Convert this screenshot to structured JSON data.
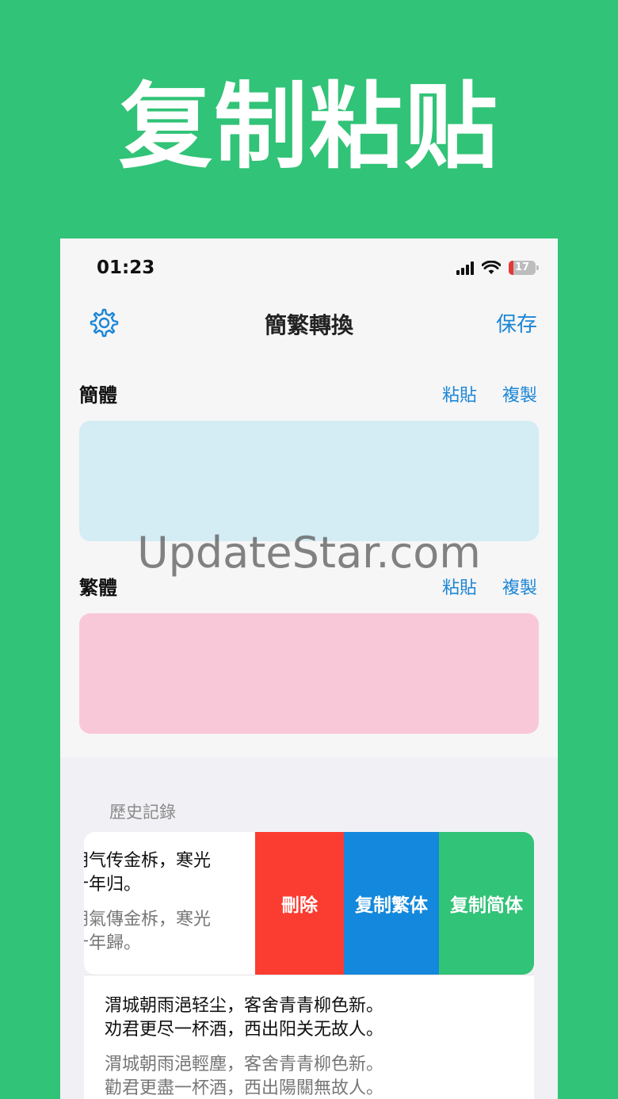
{
  "banner": {
    "title": "复制粘贴"
  },
  "status": {
    "time": "01:23",
    "battery": "17"
  },
  "nav": {
    "title": "簡繁轉換",
    "save_label": "保存",
    "settings_icon": "gear-icon"
  },
  "simplified": {
    "label": "簡體",
    "paste_label": "粘貼",
    "copy_label": "複製"
  },
  "traditional": {
    "label": "繁體",
    "paste_label": "粘貼",
    "copy_label": "複製"
  },
  "history": {
    "title": "歷史記錄",
    "items": [
      {
        "simplified_lines": [
          "朔气传金柝，寒光",
          "十年归。"
        ],
        "traditional_lines": [
          "朔氣傳金柝，寒光",
          "十年歸。"
        ],
        "actions": {
          "delete": "刪除",
          "copy_traditional": "复制繁体",
          "copy_simplified": "复制简体"
        }
      },
      {
        "simplified_lines": [
          "渭城朝雨浥轻尘，客舍青青柳色新。",
          "劝君更尽一杯酒，西出阳关无故人。"
        ],
        "traditional_lines": [
          "渭城朝雨浥輕塵，客舍青青柳色新。",
          "勸君更盡一杯酒，西出陽關無故人。"
        ]
      }
    ]
  },
  "watermark": "UpdateStar.com",
  "colors": {
    "background": "#31c377",
    "accent": "#1c86d6",
    "delete": "#fb3c30",
    "copy_trad": "#1488dc",
    "copy_simp": "#31c377"
  }
}
